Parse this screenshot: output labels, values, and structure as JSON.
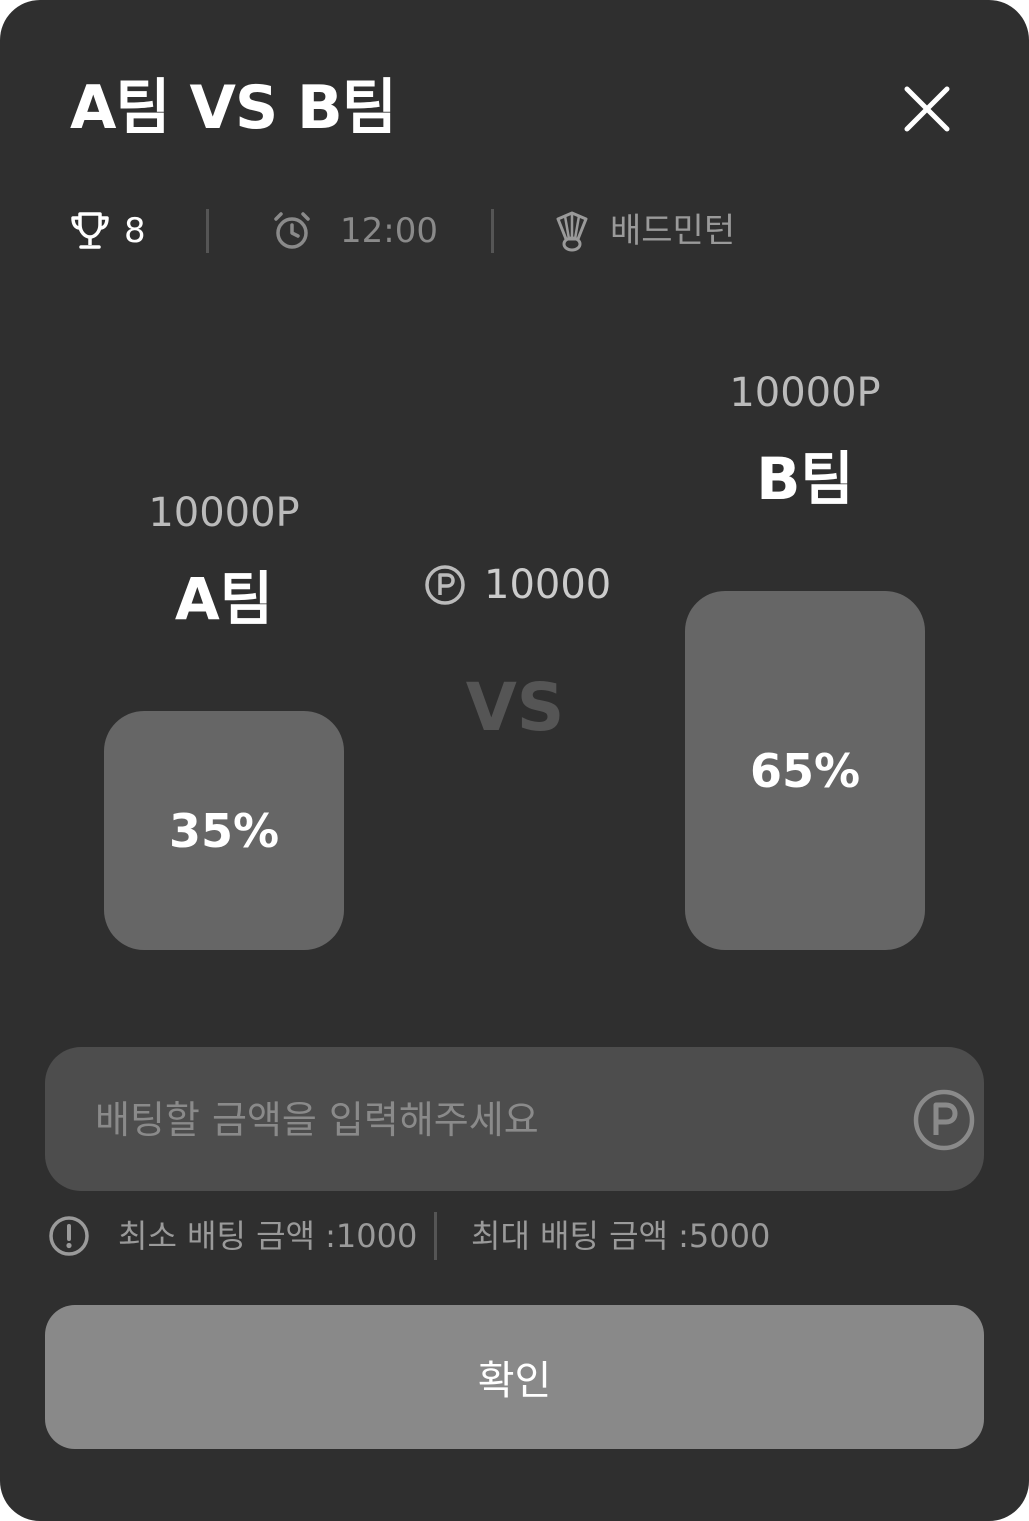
{
  "header": {
    "title": "A팀 VS B팀",
    "close_icon": "close-icon"
  },
  "meta": {
    "trophy_icon": "trophy-icon",
    "trophy_count": "8",
    "alarm_icon": "alarm-clock-icon",
    "time": "12:00",
    "sport_icon": "shuttlecock-icon",
    "sport": "배드민턴"
  },
  "teams": {
    "a": {
      "points": "10000P",
      "name": "A팀",
      "percent_label": "35%",
      "percent": 35
    },
    "b": {
      "points": "10000P",
      "name": "B팀",
      "percent_label": "65%",
      "percent": 65
    }
  },
  "pool": {
    "point_icon": "point-coin-icon",
    "amount": "10000"
  },
  "vs_label": "VS",
  "bet_input": {
    "placeholder": "배팅할 금액을 입력해주세요",
    "value": "",
    "point_icon": "point-coin-icon"
  },
  "limits": {
    "info_icon": "exclamation-circle-icon",
    "min_label": "최소 배팅 금액 :1000",
    "max_label": "최대 배팅 금액 :5000"
  },
  "confirm_label": "확인",
  "colors": {
    "background": "#2f2f2f",
    "bar": "#666666",
    "input_bg": "#4d4d4d",
    "button_bg": "#898989",
    "muted_text": "#9a9a9a"
  }
}
